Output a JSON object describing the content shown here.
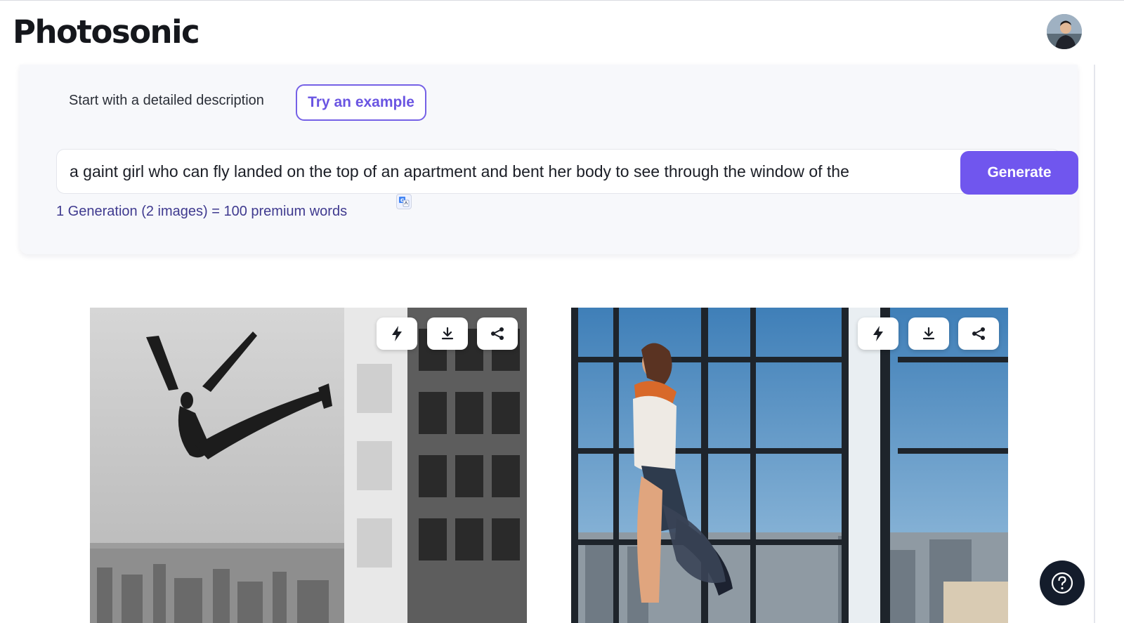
{
  "app": {
    "title": "Photosonic"
  },
  "user": {
    "avatar_icon": "user-avatar"
  },
  "prompt_panel": {
    "intro_label": "Start with a detailed description",
    "example_button": "Try an example",
    "prompt_value": "a gaint girl who can fly landed on the top of an apartment and bent her body to see through the window of the",
    "generate_button": "Generate",
    "cost_note": "1 Generation (2 images) = 100 premium words",
    "translate_icon": "google-translate-icon"
  },
  "results": {
    "images": [
      {
        "style": "black-and-white",
        "subject": "flying figure above city beside apartment building"
      },
      {
        "style": "color",
        "subject": "woman leaping in front of large apartment window"
      }
    ],
    "image_actions": [
      "bolt-icon",
      "download-icon",
      "share-icon"
    ]
  },
  "help": {
    "icon": "help-icon"
  },
  "colors": {
    "accent": "#7056ee",
    "accent_text": "#6a55e2",
    "cost_text": "#3f3a8f",
    "help_bg": "#141c2b"
  }
}
